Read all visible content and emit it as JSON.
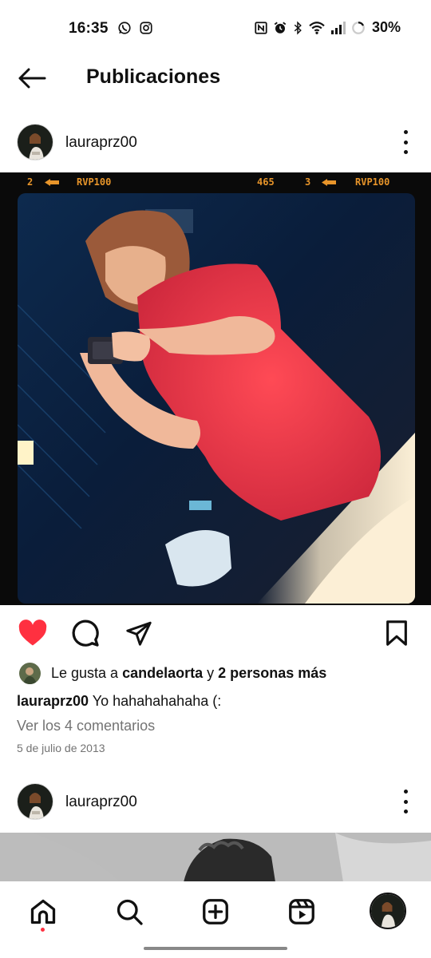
{
  "status_bar": {
    "time": "16:35",
    "left_icons": [
      "whatsapp-icon",
      "instagram-icon"
    ],
    "right_icons": [
      "nfc-icon",
      "alarm-icon",
      "bluetooth-icon",
      "wifi-icon",
      "signal-icon",
      "battery-icon"
    ],
    "battery": "30%"
  },
  "header": {
    "title": "Publicaciones",
    "back_icon": "arrow-left-icon"
  },
  "post": {
    "username": "lauraprz00",
    "film_strip": {
      "left_number": "2",
      "left_code": "RVP100",
      "mid_number": "465",
      "right_number": "3",
      "right_code": "RVP100"
    },
    "liked": true,
    "colors": {
      "like": "#ff3040",
      "muted_text": "#737373"
    },
    "likes": {
      "prefix": "Le gusta a",
      "user": "candelaorta",
      "connector": "y",
      "others": "2 personas más"
    },
    "caption_username": "lauraprz00",
    "caption_text": "Yo hahahahahaha (:",
    "comments_link": "Ver los 4 comentarios",
    "date": "5 de julio de 2013"
  },
  "next_post": {
    "username": "lauraprz00"
  },
  "bottom_nav": {
    "items": [
      "home-icon",
      "search-icon",
      "create-icon",
      "reels-icon",
      "profile-avatar"
    ],
    "active": "home-icon"
  }
}
